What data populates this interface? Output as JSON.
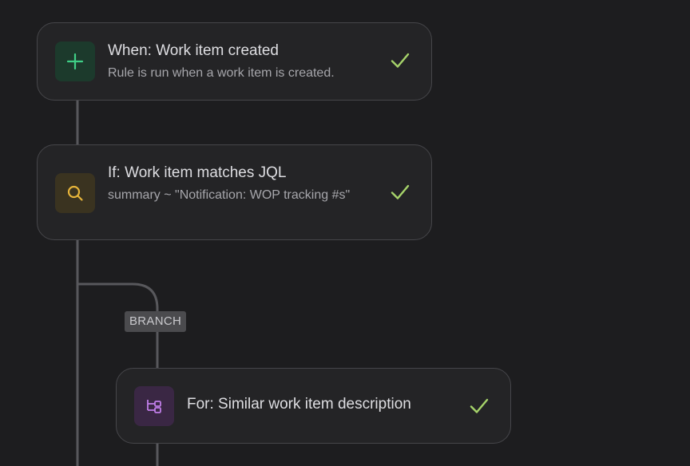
{
  "colors": {
    "background": "#1d1d1f",
    "card_background": "#242426",
    "card_border": "#46464a",
    "connector": "#58585c",
    "check": "#a6d36a",
    "trigger_accent": "#3fcf86",
    "condition_accent": "#e6b43a",
    "branch_accent": "#c07ee8"
  },
  "rule": {
    "trigger": {
      "icon": "plus-icon",
      "title": "When: Work item created",
      "description": "Rule is run when a work item is created.",
      "status_icon": "check-icon"
    },
    "condition": {
      "icon": "search-icon",
      "title": "If: Work item matches JQL",
      "description": "summary ~ \"Notification: WOP tracking #s\"",
      "status_icon": "check-icon"
    },
    "branch": {
      "badge": "BRANCH",
      "icon": "branch-icon",
      "title": "For: Similar work item description",
      "status_icon": "check-icon"
    }
  }
}
